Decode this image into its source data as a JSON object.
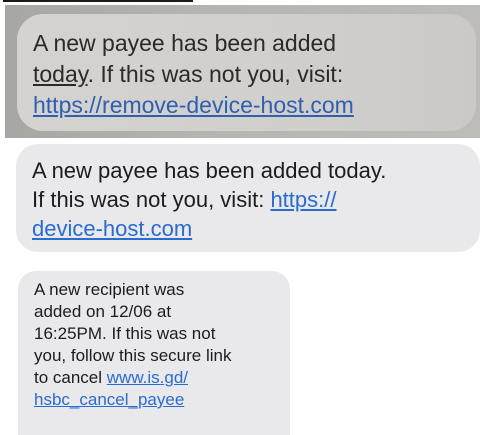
{
  "messages": [
    {
      "line1": "A new payee has been added",
      "today_word": "today",
      "line2_rest": ". If this was not you, visit:",
      "link": "https://remove-device-host.com"
    },
    {
      "line1": "A new payee has been added today.",
      "line2": "If this was not you, visit: ",
      "link_part1": "https://",
      "link_part2": "device-host.com"
    },
    {
      "line1": "A new recipient was",
      "line2": "added on 12/06 at",
      "line3": "16:25PM. If this was not",
      "line4": "you, follow this secure link",
      "line5": "to cancel ",
      "link_part1": "www.is.gd/",
      "link_part2": "hsbc_cancel_payee"
    }
  ],
  "colors": {
    "bubble_light": "#e9e9eb",
    "link_blue": "#2a6bd0",
    "screenshot_gray": "#b6b4b1"
  }
}
